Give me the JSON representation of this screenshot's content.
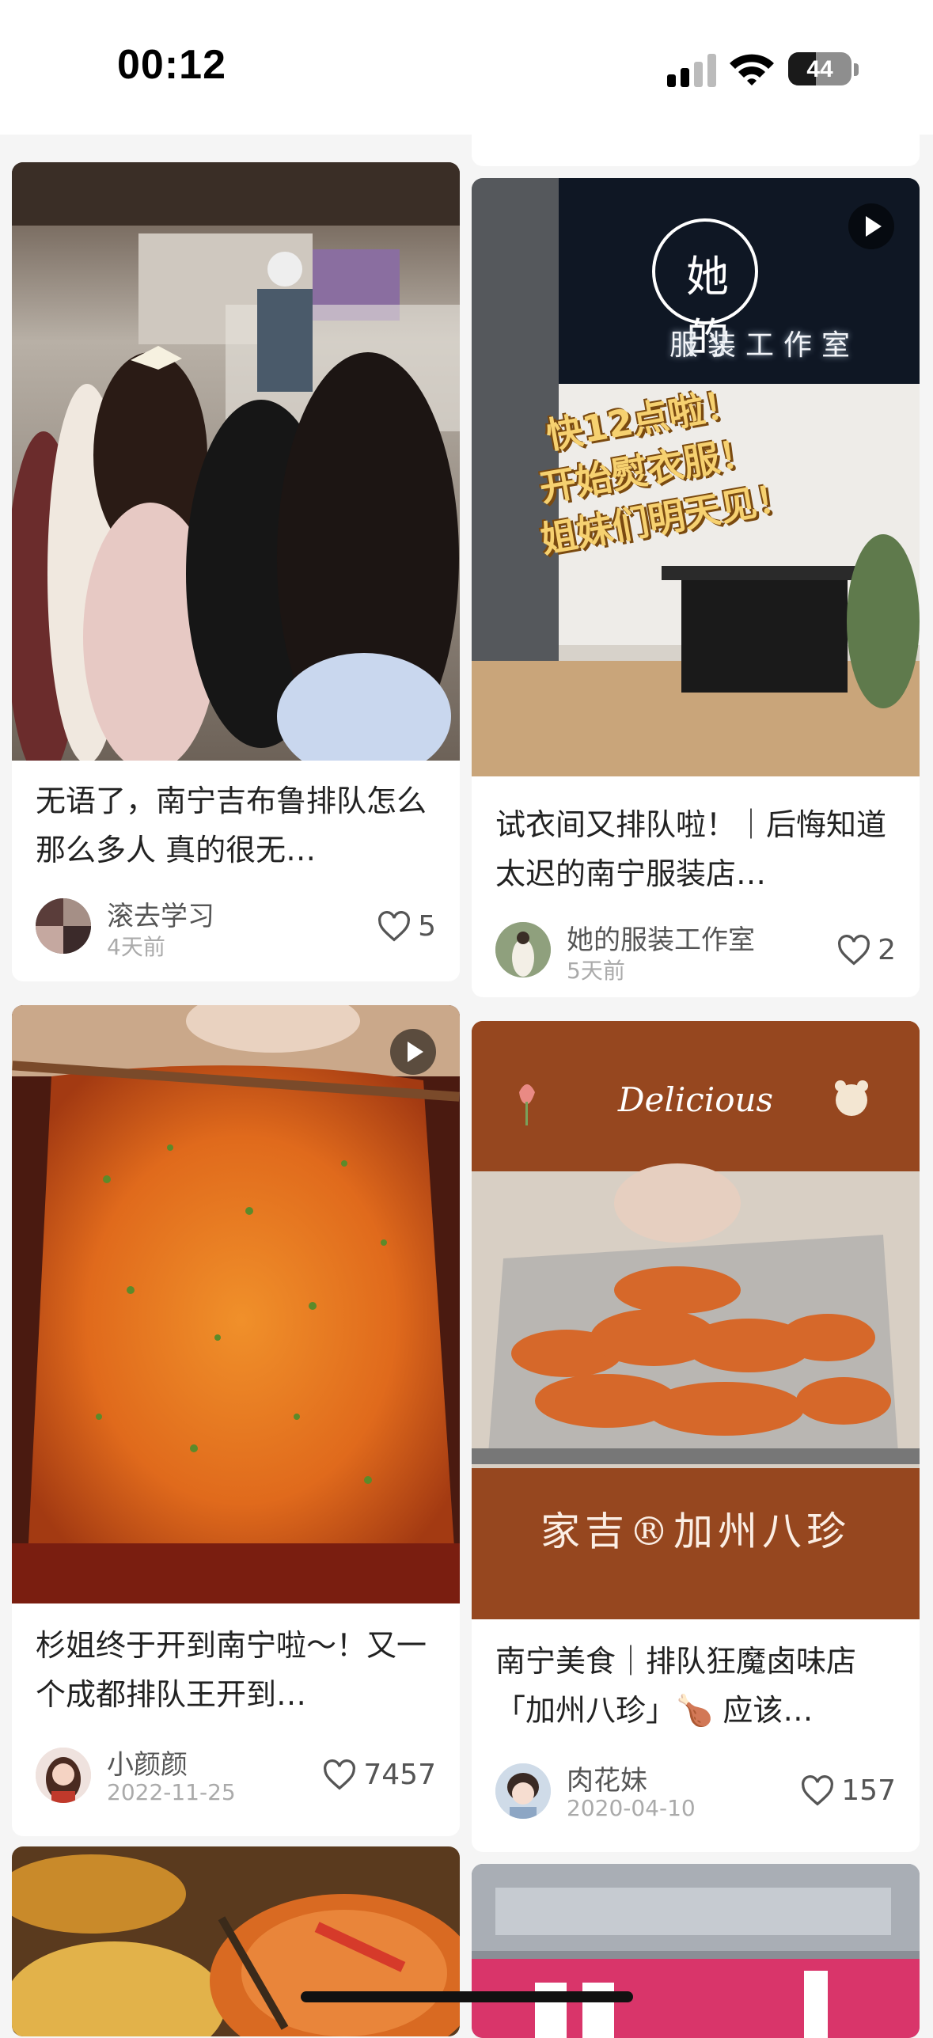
{
  "status_bar": {
    "time": "00:12",
    "battery": "44",
    "battery_level": 0.44
  },
  "feed": [
    {
      "title": "无语了，南宁吉布鲁排队怎么那么多人 真的很无…",
      "author": "滚去学习",
      "date": "4天前",
      "likes": "5",
      "has_video": false
    },
    {
      "title": "试衣间又排队啦！｜后悔知道太迟的南宁服装店…",
      "author": "她的服装工作室",
      "date": "5天前",
      "likes": "2",
      "has_video": true,
      "image_text": {
        "logo": "她的",
        "sign": "服装工作室",
        "line1": "快12点啦！",
        "line2": "开始熨衣服！",
        "line3": "姐妹们明天见！"
      }
    },
    {
      "title": "杉姐终于开到南宁啦～！又一个成都排队王开到…",
      "author": "小颜颜",
      "date": "2022-11-25",
      "likes": "7457",
      "has_video": true
    },
    {
      "title": "南宁美食｜排队狂魔卤味店「加州八珍」🍗 应该…",
      "author": "肉花妹",
      "date": "2020-04-10",
      "likes": "157",
      "has_video": false,
      "image_text": {
        "header": "Delicious",
        "brand": "家吉®加州八珍"
      }
    }
  ]
}
